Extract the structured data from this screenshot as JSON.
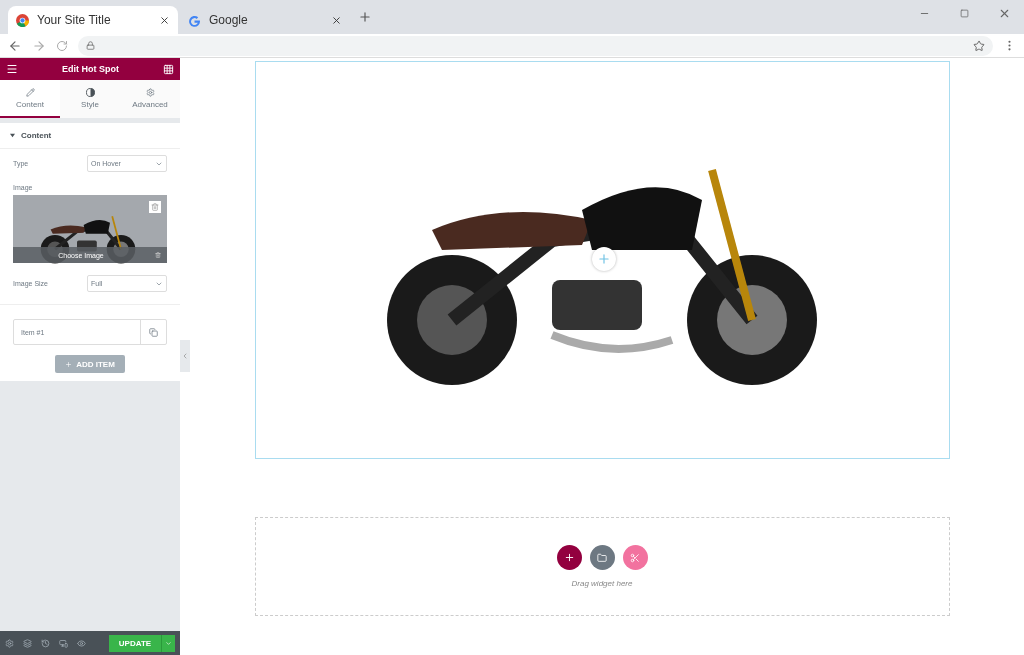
{
  "browser": {
    "tabs": [
      {
        "title": "Your Site Title",
        "selected": true,
        "kind": "chrome"
      },
      {
        "title": "Google",
        "selected": false,
        "kind": "google"
      }
    ]
  },
  "panel": {
    "title": "Edit Hot Spot",
    "tabs": [
      {
        "label": "Content",
        "selected": true,
        "kind": "pencil"
      },
      {
        "label": "Style",
        "selected": false,
        "kind": "contrast"
      },
      {
        "label": "Advanced",
        "selected": false,
        "kind": "gear"
      }
    ],
    "section": {
      "title": "Content",
      "expanded": true
    },
    "type": {
      "label": "Type",
      "value": "On Hover"
    },
    "image": {
      "label": "Image",
      "action": "Choose Image"
    },
    "image_size": {
      "label": "Image Size",
      "value": "Full"
    },
    "items": [
      {
        "label": "Item #1"
      }
    ],
    "add_item": "ADD ITEM",
    "update": "UPDATE"
  },
  "canvas": {
    "drop_text": "Drag widget here"
  }
}
